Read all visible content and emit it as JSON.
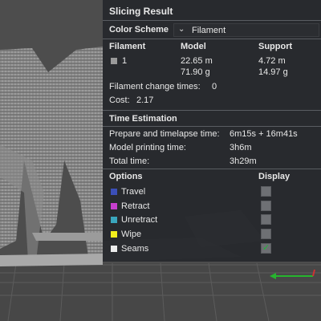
{
  "panel": {
    "title": "Slicing Result",
    "color_scheme": {
      "label": "Color Scheme",
      "selected": "Filament"
    },
    "filament_table": {
      "headers": {
        "filament": "Filament",
        "model": "Model",
        "support": "Support"
      },
      "row": {
        "index": "1",
        "swatch_color": "#9a9a9a",
        "model_length": "22.65 m",
        "model_weight": "71.90 g",
        "support_length": "4.72 m",
        "support_weight": "14.97 g"
      }
    },
    "filament_change": {
      "label": "Filament change times:",
      "value": "0"
    },
    "cost": {
      "label": "Cost:",
      "value": "2.17"
    },
    "time_estimation": {
      "title": "Time Estimation",
      "rows": [
        {
          "label": "Prepare and timelapse time:",
          "value": "6m15s + 16m41s"
        },
        {
          "label": "Model printing time:",
          "value": "3h6m"
        },
        {
          "label": "Total time:",
          "value": "3h29m"
        }
      ]
    },
    "options": {
      "header": "Options",
      "display_header": "Display",
      "items": [
        {
          "label": "Travel",
          "color": "#3b4fb8",
          "checked": false
        },
        {
          "label": "Retract",
          "color": "#c83fcf",
          "checked": false
        },
        {
          "label": "Unretract",
          "color": "#3aa6bd",
          "checked": false
        },
        {
          "label": "Wipe",
          "color": "#f2ee1c",
          "checked": false
        },
        {
          "label": "Seams",
          "color": "#ececec",
          "checked": true
        }
      ]
    }
  }
}
